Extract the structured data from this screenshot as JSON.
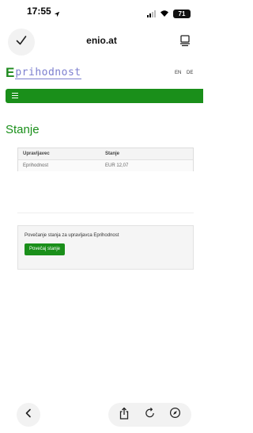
{
  "status_bar": {
    "time": "17:55",
    "battery": "71"
  },
  "browser": {
    "url": "enio.at"
  },
  "site": {
    "logo_mark": "E",
    "logo_text": "prihodnost",
    "languages": [
      "EN",
      "DE"
    ]
  },
  "page": {
    "title": "Stanje"
  },
  "table": {
    "headers": [
      "Upravljavec",
      "Stanje"
    ],
    "rows": [
      {
        "manager": "Eprihodnost",
        "balance": "EUR 12,07"
      }
    ]
  },
  "topup": {
    "text": "Povečanje stanja za upravljavca Eprihodnost",
    "button_label": "Povečaj stanje"
  },
  "icons": {
    "done": "checkmark-icon",
    "tabs": "tabs-icon",
    "menu": "hamburger-icon",
    "back": "chevron-left-icon",
    "share": "share-icon",
    "reload": "reload-icon",
    "compass": "compass-icon"
  },
  "colors": {
    "brand_green": "#1a8f1a",
    "logo_purple": "#7c7fcf"
  }
}
